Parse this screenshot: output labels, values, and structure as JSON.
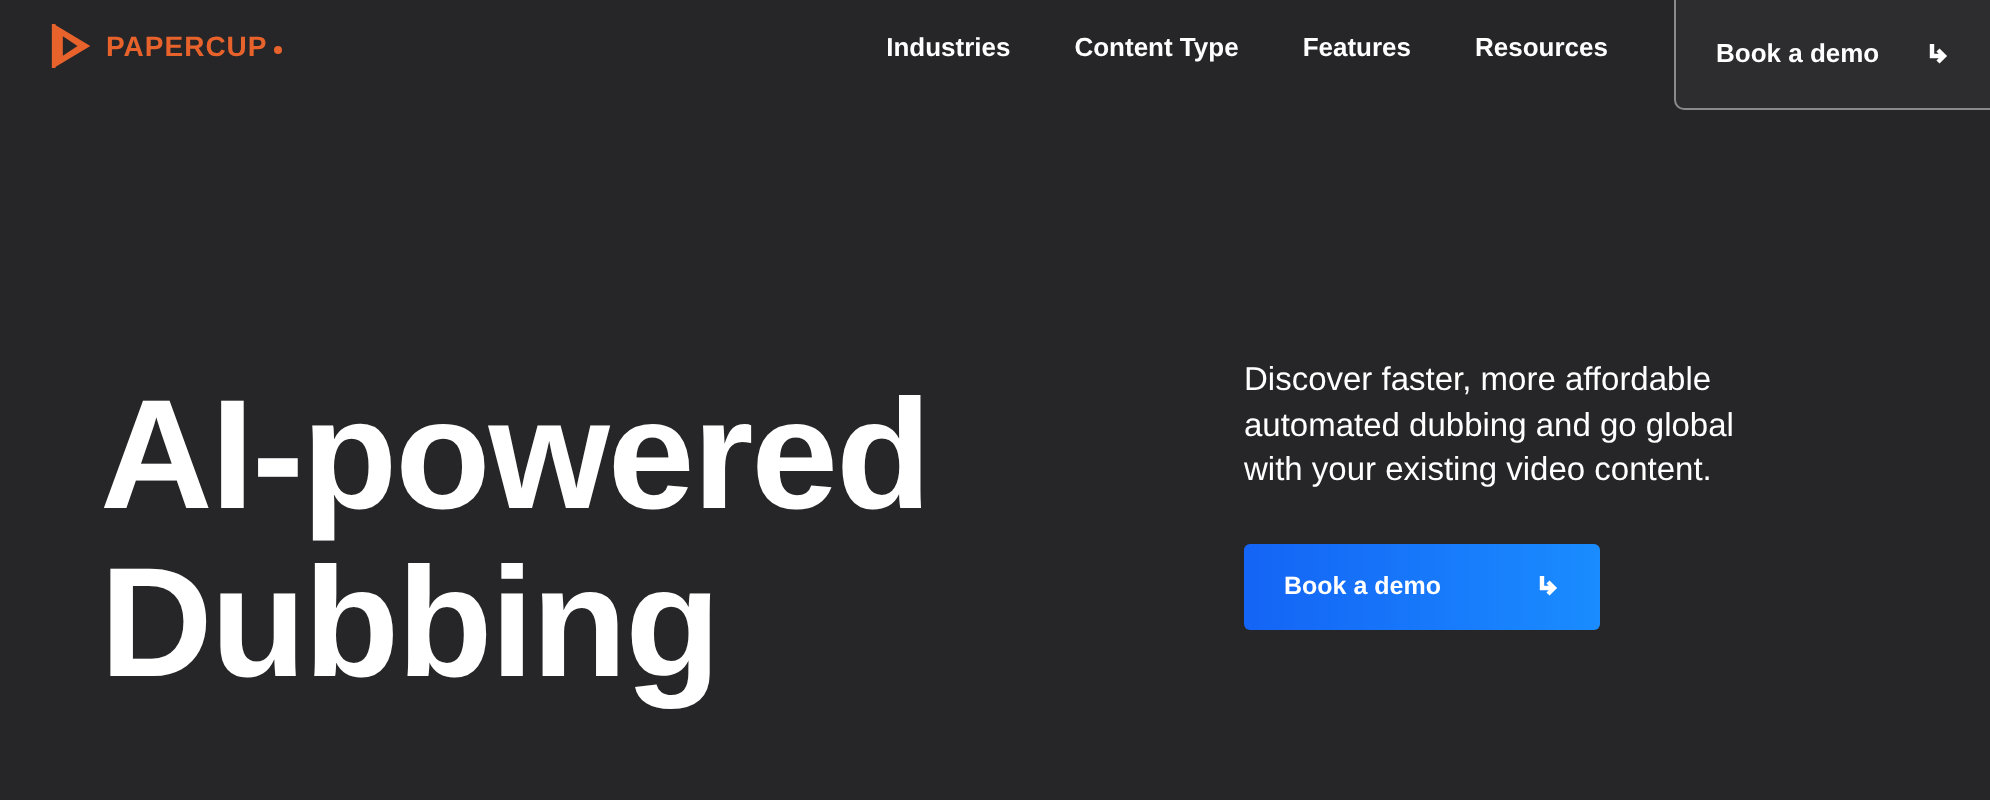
{
  "logo": {
    "text": "PAPERCUP"
  },
  "nav": [
    {
      "label": "Industries"
    },
    {
      "label": "Content Type"
    },
    {
      "label": "Features"
    },
    {
      "label": "Resources"
    }
  ],
  "header_button": {
    "label": "Book a demo"
  },
  "hero": {
    "headline": [
      "AI-powered",
      "Dubbing"
    ],
    "description": "Discover faster, more affordable automated dubbing and go global with your existing video content.",
    "button": {
      "label": "Book a demo"
    }
  }
}
